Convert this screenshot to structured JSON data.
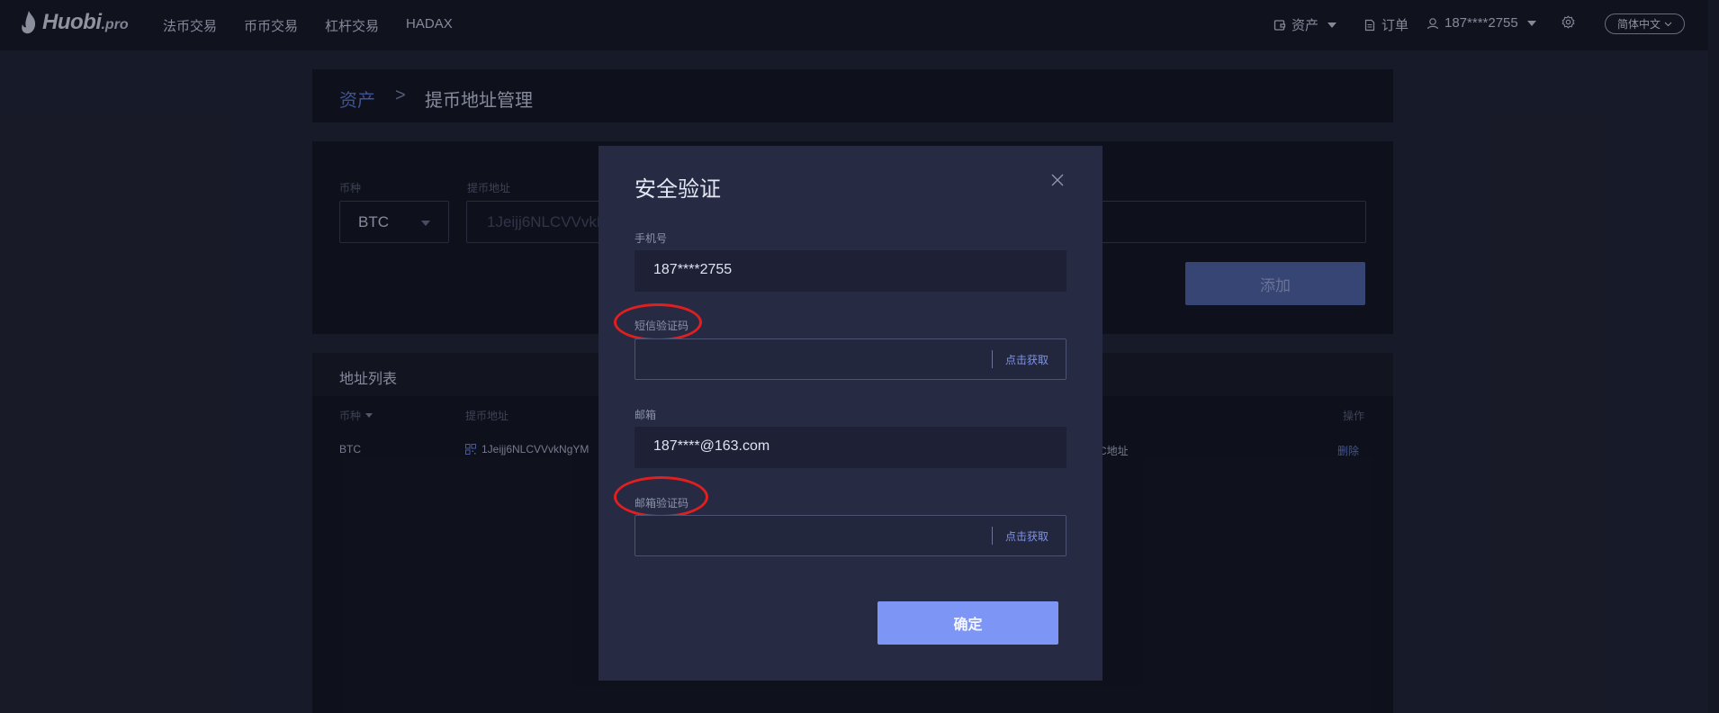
{
  "topbar": {
    "brand": "Huobi",
    "tld": ".pro",
    "nav": [
      "法币交易",
      "币币交易",
      "杠杆交易",
      "HADAX"
    ],
    "assets_label": "资产",
    "orders_label": "订单",
    "user_label": "187****2755",
    "language_label": "简体中文"
  },
  "breadcrumb": {
    "parent": "资产",
    "separator": ">",
    "current": "提币地址管理"
  },
  "form": {
    "currency_label": "币种",
    "currency_value": "BTC",
    "address_label": "提币地址",
    "address_value": "1Jeijj6NLCVVvkN",
    "add_button": "添加"
  },
  "address_list": {
    "title": "地址列表",
    "columns": [
      "币种",
      "提币地址",
      "操作"
    ],
    "rows": [
      {
        "currency": "BTC",
        "address": "1Jeijj6NLCVVvkNgYM",
        "note_fragment": "C地址",
        "action": "删除"
      }
    ]
  },
  "modal": {
    "title": "安全验证",
    "phone_label": "手机号",
    "phone_value": "187****2755",
    "sms_code_label": "短信验证码",
    "sms_get_label": "点击获取",
    "email_label": "邮箱",
    "email_value": "187****@163.com",
    "email_code_label": "邮箱验证码",
    "email_get_label": "点击获取",
    "confirm_button": "确定"
  },
  "colors": {
    "accent": "#7d96f5",
    "link": "#5e78d9",
    "annotation_ring": "#e02020"
  }
}
